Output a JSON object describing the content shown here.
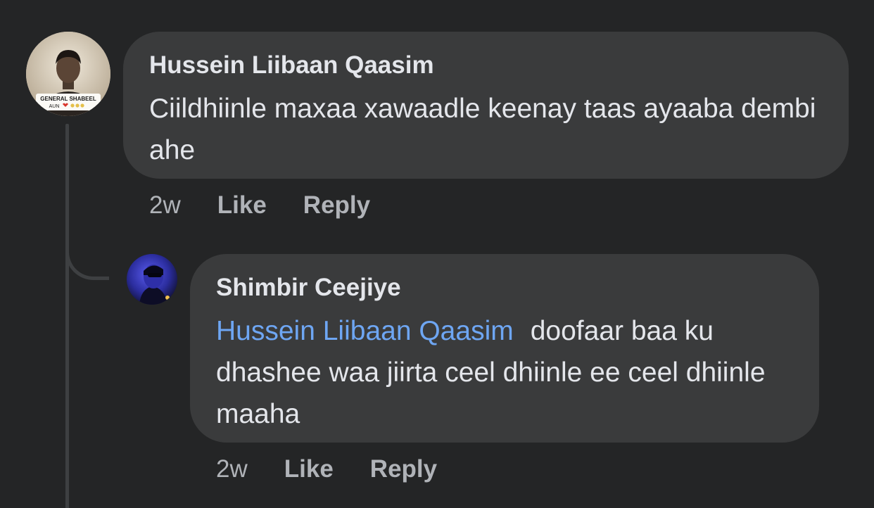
{
  "comments": [
    {
      "author": "Hussein Liibaan Qaasim",
      "text": "Ciildhiinle maxaa xawaadle keenay taas ayaaba dembi ahe",
      "time": "2w",
      "like_label": "Like",
      "reply_label": "Reply",
      "avatar": {
        "caption_line1": "GENERAL SHABEEL",
        "caption_line2": "AUN"
      }
    }
  ],
  "replies": [
    {
      "author": "Shimbir Ceejiye",
      "mention": "Hussein Liibaan Qaasim",
      "text": "doofaar baa ku dhashee waa jiirta ceel dhiinle ee ceel dhiinle maaha",
      "time": "2w",
      "like_label": "Like",
      "reply_label": "Reply"
    }
  ],
  "colors": {
    "background": "#242526",
    "bubble": "#3a3b3c",
    "text_primary": "#e4e6eb",
    "text_secondary": "#b0b3b8",
    "mention": "#6ea6f3",
    "thread_line": "#3e4042"
  }
}
